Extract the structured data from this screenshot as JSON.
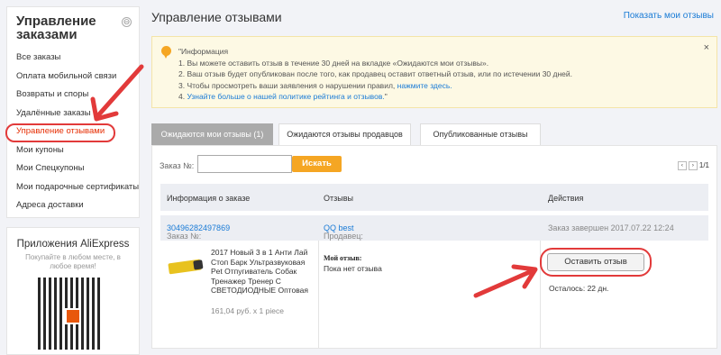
{
  "sidebar": {
    "title": "Управление заказами",
    "toggle": "⊖",
    "items": [
      {
        "label": "Все заказы"
      },
      {
        "label": "Оплата мобильной связи"
      },
      {
        "label": "Возвраты и споры"
      },
      {
        "label": "Удалённые заказы"
      },
      {
        "label": "Управление отзывами"
      },
      {
        "label": "Мои купоны"
      },
      {
        "label": "Мои Спецкупоны"
      },
      {
        "label": "Мои подарочные сертификаты"
      },
      {
        "label": "Адреса доставки"
      }
    ]
  },
  "apps": {
    "title": "Приложения AliExpress",
    "subtitle": "Покупайте в любом месте, в любое время!"
  },
  "main": {
    "title": "Управление отзывами",
    "show_reviews_link": "Показать мои отзывы",
    "info": {
      "heading": "\"Информация",
      "line1": "1. Вы можете оставить отзыв в течение 30 дней на вкладке «Ожидаются мои отзывы».",
      "line2": "2. Ваш отзыв будет опубликован после того, как продавец оставит ответный отзыв, или по истечении 30 дней.",
      "line3_text": "3. Чтобы просмотреть ваши заявления о нарушении правил, ",
      "line3_link": "нажмите здесь.",
      "line4_prefix": "4. ",
      "line4_link": "Узнайте больше о нашей политике рейтинга и отзывов.",
      "line4_suffix": "\"",
      "close": "×"
    },
    "tabs": [
      {
        "label": "Ожидаются мои отзывы (1)"
      },
      {
        "label": "Ожидаются отзывы продавцов"
      },
      {
        "label": "Опубликованные отзывы"
      }
    ],
    "search": {
      "label": "Заказ №:",
      "value": "",
      "button": "Искать"
    },
    "pager": {
      "prev": "‹",
      "next": "›",
      "text": "1/1"
    },
    "table": {
      "headers": [
        "Информация о заказе",
        "Отзывы",
        "Действия"
      ],
      "order_row": {
        "order_label": "Заказ №:",
        "order_number": "30496282497869",
        "seller_label": "Продавец:",
        "seller_name": "QQ best",
        "status": "Заказ завершен 2017.07.22 12:24"
      },
      "item": {
        "name": "2017 Новый 3 в 1 Анти Лай Стоп Барк Ультразвуковая Pet Отпугиватель Собак Тренажер Тренер С СВЕТОДИОДНЫЕ Оптовая",
        "price": "161,04 руб. x 1 piece",
        "review_label": "Мой отзыв:",
        "review_value": "Пока нет отзыва",
        "action_button": "Оставить отзыв",
        "remaining": "Осталось: 22 дн."
      }
    }
  },
  "colors": {
    "accent_orange": "#f5a623",
    "link_blue": "#1a7bd6",
    "highlight_red": "#e23a3a"
  }
}
